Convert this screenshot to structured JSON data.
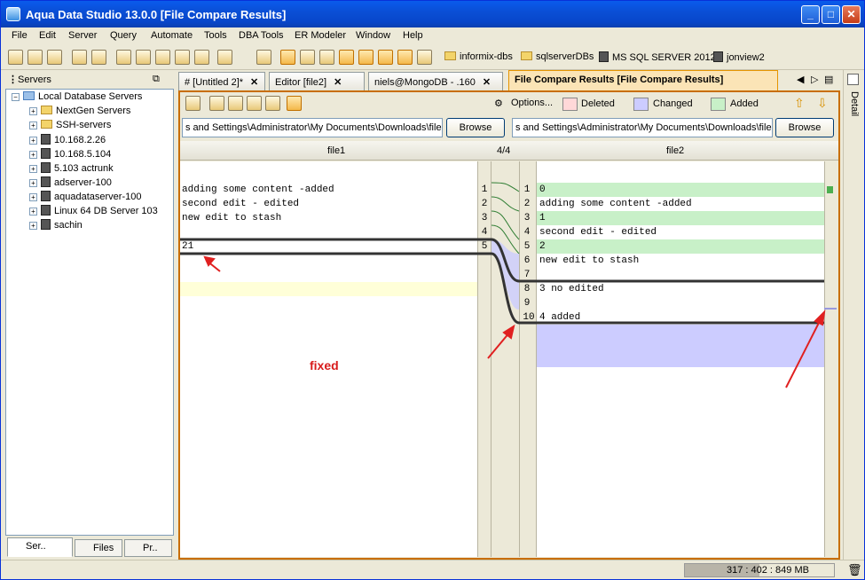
{
  "window": {
    "title": "Aqua Data Studio 13.0.0 [File Compare Results]"
  },
  "menu": [
    "File",
    "Edit",
    "Server",
    "Query",
    "Automate",
    "Tools",
    "DBA Tools",
    "ER Modeler",
    "Window",
    "Help"
  ],
  "favorites": [
    "informix-dbs",
    "sqlserverDBs",
    "MS SQL SERVER 2012",
    "jonview2"
  ],
  "servers_panel": {
    "title": "Servers",
    "tree": [
      {
        "label": "Local Database Servers",
        "type": "root"
      },
      {
        "label": "NextGen Servers",
        "type": "folder"
      },
      {
        "label": "SSH-servers",
        "type": "folder"
      },
      {
        "label": "10.168.2.26",
        "type": "server"
      },
      {
        "label": "10.168.5.104",
        "type": "server"
      },
      {
        "label": "5.103 actrunk",
        "type": "server"
      },
      {
        "label": "adserver-100",
        "type": "server"
      },
      {
        "label": "aquadataserver-100",
        "type": "server"
      },
      {
        "label": "Linux 64 DB Server 103",
        "type": "server"
      },
      {
        "label": "sachin",
        "type": "server"
      }
    ],
    "tabs": [
      "Ser..",
      "Files",
      "Pr.."
    ]
  },
  "doc_tabs": [
    {
      "label": "# [Untitled 2]*",
      "close": "✕"
    },
    {
      "label": "Editor [file2]",
      "close": "✕"
    },
    {
      "label": "niels@MongoDB - .160",
      "close": "✕"
    },
    {
      "label": "File Compare Results [File Compare Results]",
      "close": ""
    }
  ],
  "compare": {
    "options_label": "Options...",
    "legend": {
      "deleted": "Deleted",
      "changed": "Changed",
      "added": "Added"
    },
    "colors": {
      "deleted": "#ffd8d8",
      "changed": "#ccccff",
      "added": "#c8f0c8",
      "current": "#ffffd8",
      "accent": "#c86e00"
    },
    "file1_path": "s and Settings\\Administrator\\My Documents\\Downloads\\file1",
    "file2_path": "s and Settings\\Administrator\\My Documents\\Downloads\\file2",
    "browse": "Browse",
    "left_header": "file1",
    "center_header": "4/4",
    "right_header": "file2",
    "left_lines": [
      {
        "num": "1",
        "text": "adding some content -added"
      },
      {
        "num": "2",
        "text": "second edit - edited"
      },
      {
        "num": "3",
        "text": "new edit to stash"
      },
      {
        "num": "4",
        "text": ""
      },
      {
        "num": "5",
        "text": "21"
      }
    ],
    "right_lines": [
      {
        "num": "1",
        "text": "0",
        "state": "added"
      },
      {
        "num": "2",
        "text": "adding some content -added",
        "state": "none"
      },
      {
        "num": "3",
        "text": "1",
        "state": "added"
      },
      {
        "num": "4",
        "text": "second edit - edited",
        "state": "none"
      },
      {
        "num": "5",
        "text": "2",
        "state": "added"
      },
      {
        "num": "6",
        "text": "new edit to stash",
        "state": "none"
      },
      {
        "num": "7",
        "text": "",
        "state": "none"
      },
      {
        "num": "8",
        "text": "3 no edited",
        "state": "changed"
      },
      {
        "num": "9",
        "text": "",
        "state": "changed"
      },
      {
        "num": "10",
        "text": "4 added",
        "state": "changed"
      }
    ],
    "annotation": "fixed"
  },
  "detail_label": "Detail",
  "status": {
    "memory": "317 : 402 : 849 MB"
  }
}
